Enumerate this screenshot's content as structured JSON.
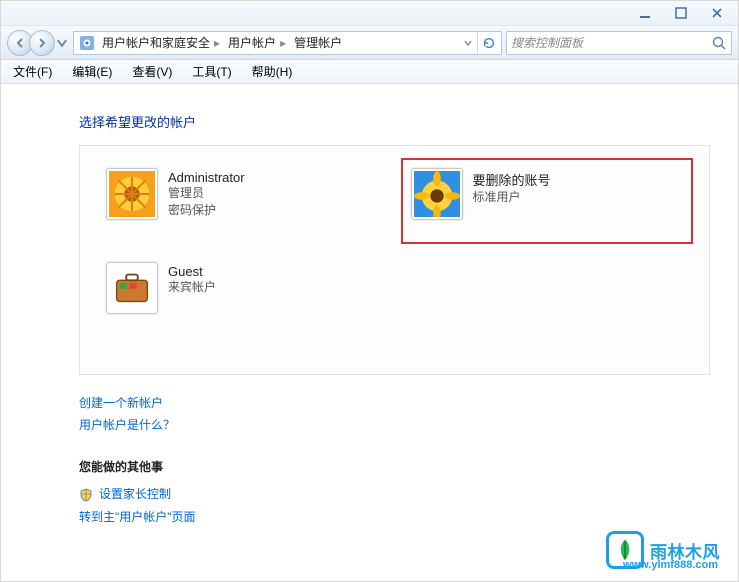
{
  "breadcrumb": {
    "root_icon": "control-panel",
    "segments": [
      "用户帐户和家庭安全",
      "用户帐户",
      "管理帐户"
    ]
  },
  "search": {
    "placeholder": "搜索控制面板"
  },
  "menu": {
    "file": "文件(F)",
    "edit": "编辑(E)",
    "view": "查看(V)",
    "tools": "工具(T)",
    "help": "帮助(H)"
  },
  "heading": "选择希望更改的帐户",
  "accounts": {
    "admin": {
      "name": "Administrator",
      "role": "管理员",
      "extra": "密码保护"
    },
    "target": {
      "name": "要删除的账号",
      "role": "标准用户",
      "extra": ""
    },
    "guest": {
      "name": "Guest",
      "role": "来宾帐户",
      "extra": ""
    }
  },
  "links": {
    "create": "创建一个新帐户",
    "whatis": "用户帐户是什么？"
  },
  "other": {
    "title": "您能做的其他事",
    "parental": "设置家长控制",
    "goto": "转到主\"用户帐户\"页面"
  },
  "watermark": {
    "text": "雨林木风",
    "url": "www.ylmf888.com"
  }
}
